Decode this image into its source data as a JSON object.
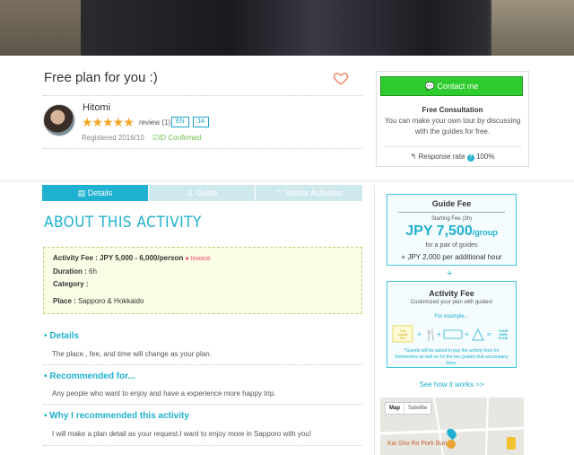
{
  "tour": {
    "title": "Free plan for you :)"
  },
  "host": {
    "name": "Hitomi",
    "rating_stars": 5,
    "stars_text": "★★★★★",
    "review_label": "review (1)",
    "languages": [
      "EN",
      "JA"
    ],
    "registered": "Registered 2016/10",
    "id_status": "ID Confirmed"
  },
  "contact": {
    "button_label": "Contact me",
    "free_title": "Free Consultation",
    "free_text": "You can make your own tour by discussing with the guides for free.",
    "response_label": "Response rate",
    "response_value": "100%"
  },
  "tabs": [
    {
      "label": "Details",
      "active": true
    },
    {
      "label": "Guide",
      "active": false
    },
    {
      "label": "Similar Activities",
      "active": false
    }
  ],
  "about": {
    "heading": "ABOUT THIS ACTIVITY",
    "activity_fee_label": "Activity Fee :",
    "activity_fee_value": "JPY 5,000 - 6,000/person",
    "invoice_label": "Invoice",
    "duration_label": "Duration :",
    "duration_value": "6h",
    "category_label": "Category :",
    "place_label": "Place :",
    "place_value": "Sapporo & Hokkaido"
  },
  "sections": [
    {
      "heading": "Details",
      "text": "The place , fee, and time will change as your plan."
    },
    {
      "heading": "Recommended for...",
      "text": "Any people who want to enjoy and have a experience more happy trip."
    },
    {
      "heading": "Why I recommended this activity",
      "text": "I will make a plan detail as your request.I want to enjoy more in Sapporo with you!"
    }
  ],
  "guide_fee": {
    "title": "Guide Fee",
    "start_label": "Starting Fee (3h)",
    "price": "JPY 7,500",
    "per": "/group",
    "pair": "for a pair of guides",
    "additional": "+ JPY 2,000 per additional hour"
  },
  "activity_fee_box": {
    "title": "Activity Fee",
    "subtitle": "Customized your plan with guides!",
    "example": "For example...",
    "icon_labels": [
      "This Activity Fee",
      "YOUR OWN PLAN!"
    ],
    "note": "*Guests will be asked to pay the activity fees for themselves as well as for the two guides that accompany them."
  },
  "see_how": "See how it works >>",
  "map": {
    "tabs": [
      "Map",
      "Satellite"
    ],
    "place_label": "Kai Sho Ro Pork Bun"
  },
  "colors": {
    "accent": "#1fb1cf",
    "contact_green": "#2ecc2e",
    "star": "#f5a623",
    "confirmed": "#6cc04a"
  }
}
